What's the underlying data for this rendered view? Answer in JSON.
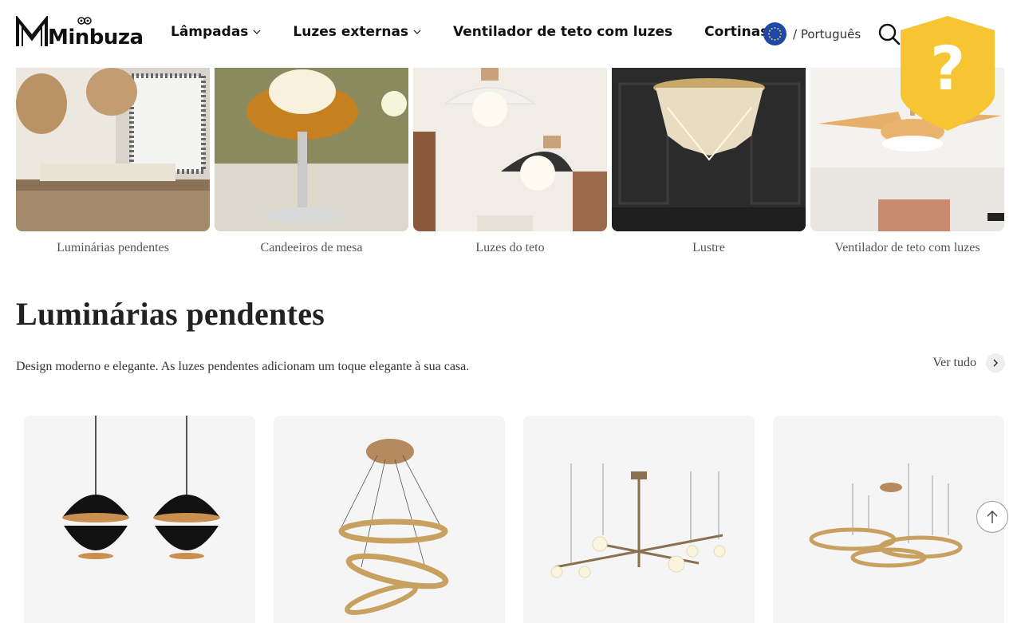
{
  "header": {
    "logo_text": "Minbuza",
    "nav": [
      {
        "label": "Lâmpadas",
        "has_dropdown": true
      },
      {
        "label": "Luzes externas",
        "has_dropdown": true
      },
      {
        "label": "Ventilador de teto com luzes",
        "has_dropdown": false
      },
      {
        "label": "Cortinas",
        "has_dropdown": false
      }
    ],
    "language": "/ Português",
    "icons": {
      "search": "search-icon",
      "flag": "eu-flag-icon",
      "help": "help-shield-icon"
    }
  },
  "categories": [
    {
      "label": "Luminárias pendentes"
    },
    {
      "label": "Candeeiros de mesa"
    },
    {
      "label": "Luzes do teto"
    },
    {
      "label": "Lustre"
    },
    {
      "label": "Ventilador de teto com luzes"
    }
  ],
  "section": {
    "title": "Luminárias pendentes",
    "description": "Design moderno e elegante. As luzes pendentes adicionam um toque elegante à sua casa.",
    "view_all": "Ver tudo"
  },
  "colors": {
    "shield": "#f7c531",
    "flag": "#1f49a8",
    "card_bg": "#f5f5f5",
    "gold": "#c9a063"
  }
}
